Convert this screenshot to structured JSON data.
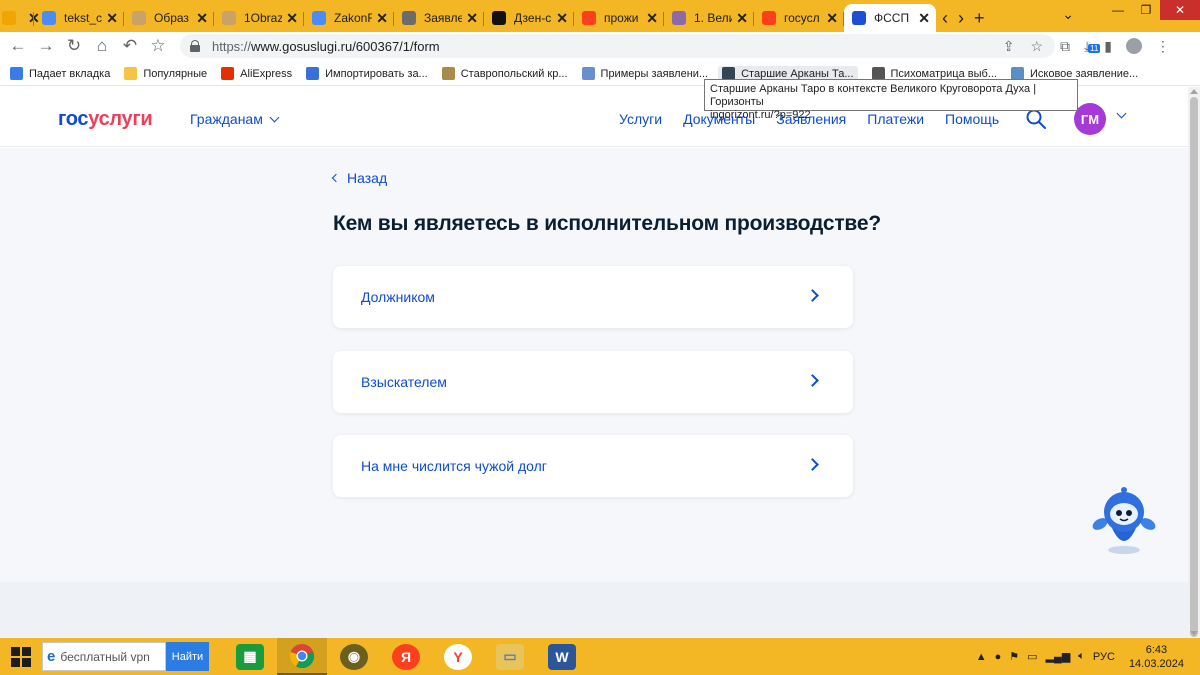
{
  "browser": {
    "tabs": [
      {
        "title": "",
        "favicon": "page-icon",
        "color": "#f0a500"
      },
      {
        "title": "tekst_c",
        "favicon": "docs-icon",
        "color": "#4c8bf5"
      },
      {
        "title": "Образ",
        "favicon": "doc-icon",
        "color": "#c9a26a"
      },
      {
        "title": "1Obraz",
        "favicon": "doc-icon",
        "color": "#c9a26a"
      },
      {
        "title": "ZakonF",
        "favicon": "docs-icon",
        "color": "#4c8bf5"
      },
      {
        "title": "Заявле",
        "favicon": "court-icon",
        "color": "#6b6b6b"
      },
      {
        "title": "Дзен-с",
        "favicon": "dzen-icon",
        "color": "#111111"
      },
      {
        "title": "прожи",
        "favicon": "yandex-icon",
        "color": "#fc3f1d"
      },
      {
        "title": "1. Вели",
        "favicon": "image-icon",
        "color": "#8c6aa8"
      },
      {
        "title": "госусл",
        "favicon": "yandex-icon",
        "color": "#fc3f1d"
      },
      {
        "title": "ФССП",
        "favicon": "russia-flag-icon",
        "color": "#1c4fd1",
        "active": true
      }
    ],
    "new_tab_label": "+",
    "window_controls": {
      "minimize": "—",
      "maximize": "❐",
      "close": "✕"
    },
    "url_scheme": "https://",
    "url_rest": "www.gosuslugi.ru/600367/1/form",
    "extension_badge": "11",
    "bookmarks": [
      {
        "label": "Падает вкладка",
        "icon": "chrome-icon",
        "color": "#3b7be9"
      },
      {
        "label": "Популярные",
        "icon": "folder-icon",
        "color": "#f6c343"
      },
      {
        "label": "AliExpress",
        "icon": "aliexpress-icon",
        "color": "#e62e04"
      },
      {
        "label": "Импортировать за...",
        "icon": "gear-icon",
        "color": "#3b6fd8"
      },
      {
        "label": "Ставропольский кр...",
        "icon": "scales-icon",
        "color": "#a88a4a"
      },
      {
        "label": "Примеры заявлени...",
        "icon": "globe-icon",
        "color": "#6a8fcf"
      },
      {
        "label": "Старшие Арканы Та...",
        "icon": "image-icon",
        "color": "#334455",
        "hover": true
      },
      {
        "label": "Психоматрица выб...",
        "icon": "grid-icon",
        "color": "#555555"
      },
      {
        "label": "Исковое заявление...",
        "icon": "snowflake-icon",
        "color": "#5a8fc2"
      }
    ],
    "tooltip": {
      "line1": "Старшие Арканы Таро в контексте Великого Круговорота Духа | Горизонты",
      "line2": "ingorizont.ru/?p=922"
    }
  },
  "site": {
    "logo": {
      "part1": "гос",
      "part2": "услуги"
    },
    "audience": "Гражданам",
    "nav": [
      "Услуги",
      "Документы",
      "Заявления",
      "Платежи",
      "Помощь"
    ],
    "avatar_initials": "ГМ",
    "back_label": "Назад",
    "question": "Кем вы являетесь в исполнительном производстве?",
    "options": [
      "Должником",
      "Взыскателем",
      "На мне числится чужой долг"
    ],
    "colors": {
      "accent": "#0d4cd3",
      "logo_red": "#ee3f58",
      "avatar": "#a63ad6",
      "page_bg": "#f5f7fa"
    }
  },
  "taskbar": {
    "search_placeholder": "бесплатный vpn",
    "find_button": "Найти",
    "apps": [
      "store-icon",
      "chrome-icon",
      "eye-app-icon",
      "yandex-icon",
      "yandex-browser-icon",
      "file-explorer-icon",
      "word-icon"
    ],
    "language": "РУС",
    "time": "6:43",
    "date": "14.03.2024"
  }
}
